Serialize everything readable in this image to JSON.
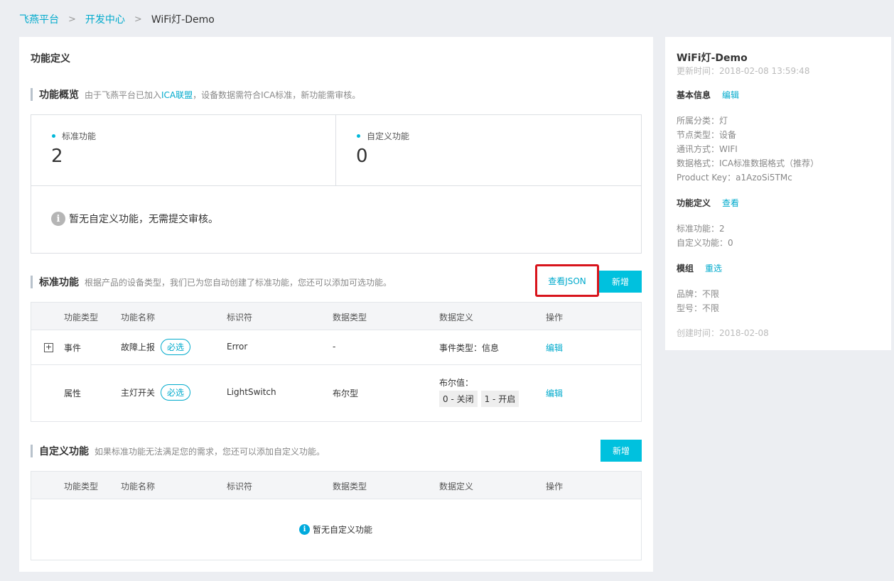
{
  "breadcrumb": {
    "items": [
      "飞燕平台",
      "开发中心"
    ],
    "current": "WiFi灯-Demo",
    "separator": ">"
  },
  "main": {
    "title": "功能定义",
    "overview": {
      "title": "功能概览",
      "desc_prefix": "由于飞燕平台已加入",
      "desc_link": "ICA联盟",
      "desc_suffix": "，设备数据需符合ICA标准，新功能需审核。",
      "standard_label": "标准功能",
      "standard_count": "2",
      "custom_label": "自定义功能",
      "custom_count": "0",
      "notice": "暂无自定义功能，无需提交审核。"
    },
    "standard": {
      "title": "标准功能",
      "desc": "根据产品的设备类型，我们已为您自动创建了标准功能，您还可以添加可选功能。",
      "view_json_label": "查看JSON",
      "add_label": "新增",
      "columns": [
        "功能类型",
        "功能名称",
        "标识符",
        "数据类型",
        "数据定义",
        "操作"
      ],
      "rows": [
        {
          "type": "事件",
          "name": "故障上报",
          "tag": "必选",
          "identifier": "Error",
          "data_type": "-",
          "definition": "事件类型：信息",
          "action": "编辑"
        },
        {
          "type": "属性",
          "name": "主灯开关",
          "tag": "必选",
          "identifier": "LightSwitch",
          "data_type": "布尔型",
          "definition_title": "布尔值：",
          "chip_0": "0 - 关闭",
          "chip_1": "1 - 开启",
          "action": "编辑"
        }
      ]
    },
    "custom": {
      "title": "自定义功能",
      "desc": "如果标准功能无法满足您的需求，您还可以添加自定义功能。",
      "add_label": "新增",
      "columns": [
        "功能类型",
        "功能名称",
        "标识符",
        "数据类型",
        "数据定义",
        "操作"
      ],
      "empty": "暂无自定义功能"
    }
  },
  "side": {
    "title": "WiFi灯-Demo",
    "updated": "更新时间：2018-02-08 13:59:48",
    "basic_title": "基本信息",
    "basic_action": "编辑",
    "basic_lines": [
      "所属分类：灯",
      "节点类型：设备",
      "通讯方式：WIFI",
      "数据格式：ICA标准数据格式（推荐）",
      "Product Key：a1AzoSi5TMc"
    ],
    "func_title": "功能定义",
    "func_action": "查看",
    "func_lines": [
      "标准功能：2",
      "自定义功能：0"
    ],
    "module_title": "模组",
    "module_action": "重选",
    "module_lines": [
      "品牌：不限",
      "型号：不限"
    ],
    "created": "创建时间：2018-02-08"
  },
  "colors": {
    "accent": "#00c1de",
    "link": "#00aacc",
    "highlight_border": "#d8141c",
    "background": "#eceef2"
  }
}
